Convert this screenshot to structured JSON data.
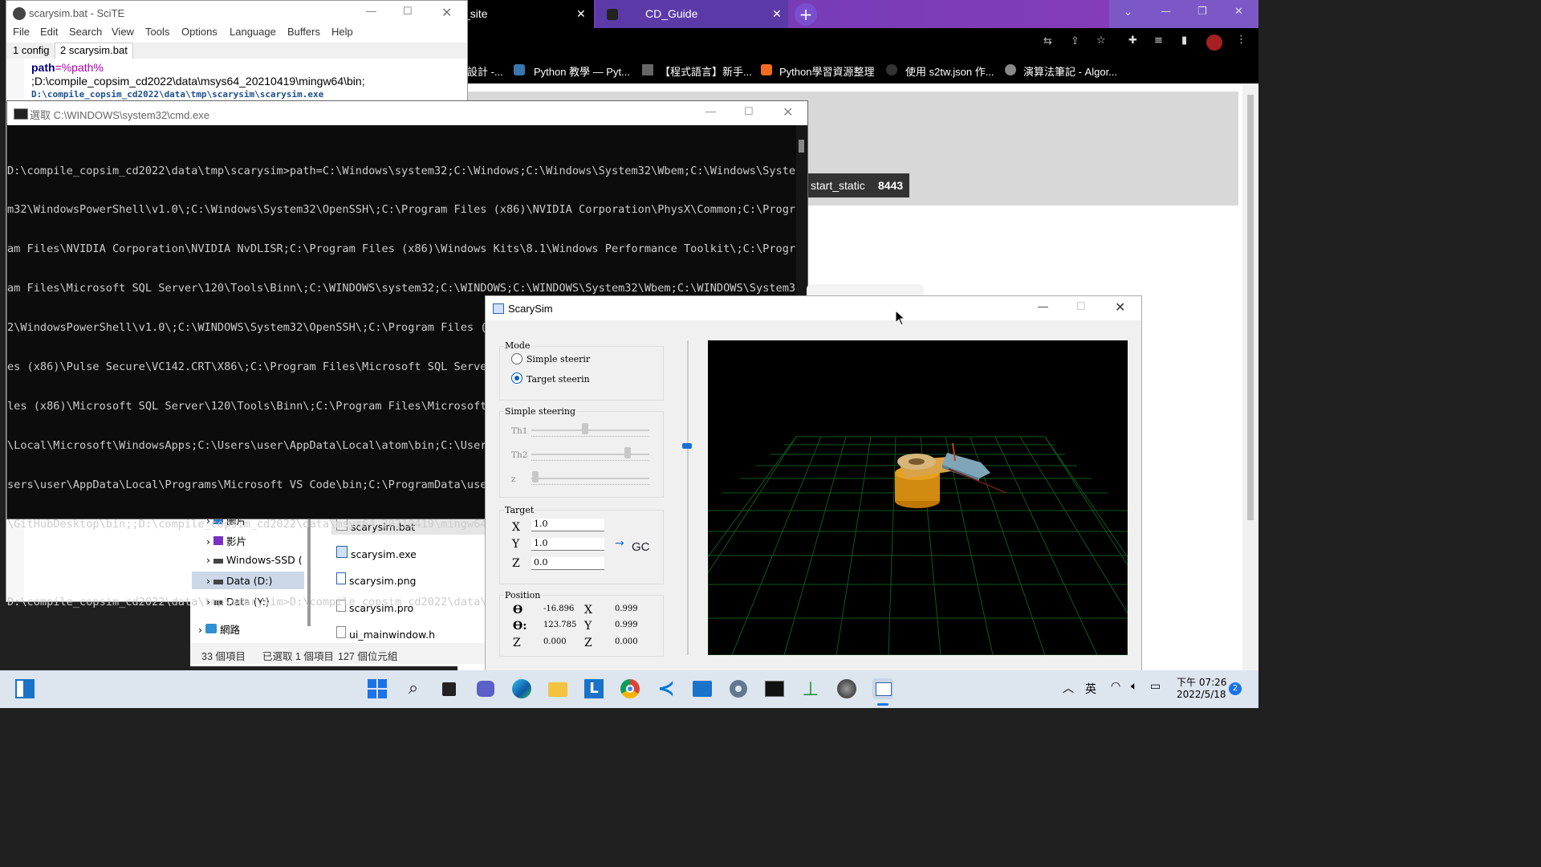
{
  "chrome": {
    "tabs": [
      {
        "title": "_site"
      },
      {
        "title": "CD_Guide"
      }
    ],
    "bookmarks": [
      "設計 -...",
      "Python 教學 — Pyt...",
      "【程式語言】新手...",
      "Python學習資源整理",
      "使用 s2tw.json 作...",
      "演算法筆記 - Algor..."
    ],
    "page": {
      "tag1": "start_static",
      "tag2": "8443"
    }
  },
  "scite": {
    "title": "scarysim.bat - SciTE",
    "menu": [
      "File",
      "Edit",
      "Search",
      "View",
      "Tools",
      "Options",
      "Language",
      "Buffers",
      "Help"
    ],
    "tabs": [
      "1 config",
      "2 scarysim.bat"
    ],
    "code": {
      "line1_kw": "path",
      "line1_rest": "=%path%",
      "line2": ";D:\\compile_copsim_cd2022\\data\\msys64_20210419\\mingw64\\bin;",
      "line3": "D:\\compile_copsim_cd2022\\data\\tmp\\scarysim\\scarysim.exe"
    }
  },
  "cmd": {
    "title": "選取 C:\\WINDOWS\\system32\\cmd.exe",
    "lines": [
      "D:\\compile_copsim_cd2022\\data\\tmp\\scarysim>path=C:\\Windows\\system32;C:\\Windows;C:\\Windows\\System32\\Wbem;C:\\Windows\\Syste",
      "m32\\WindowsPowerShell\\v1.0\\;C:\\Windows\\System32\\OpenSSH\\;C:\\Program Files (x86)\\NVIDIA Corporation\\PhysX\\Common;C:\\Progr",
      "am Files\\NVIDIA Corporation\\NVIDIA NvDLISR;C:\\Program Files (x86)\\Windows Kits\\8.1\\Windows Performance Toolkit\\;C:\\Progr",
      "am Files\\Microsoft SQL Server\\120\\Tools\\Binn\\;C:\\WINDOWS\\system32;C:\\WINDOWS;C:\\WINDOWS\\System32\\Wbem;C:\\WINDOWS\\System3",
      "2\\WindowsPowerShell\\v1.0\\;C:\\WINDOWS\\System32\\OpenSSH\\;C:\\Program Files (x86)\\Pulse Secure\\VC142.CRT\\X64\\;C:\\Program Fil",
      "es (x86)\\Pulse Secure\\VC142.CRT\\X86\\;C:\\Program Files\\Microsoft SQL Server\\Client SDK\\ODBC\\110\\Tools\\Binn\\;C:\\Program Fi",
      "les (x86)\\Microsoft SQL Server\\120\\Tools\\Binn\\;C:\\Program Files\\Microsoft SQL Server\\120\\DTS\\Binn\\;C:\\Users\\user\\AppData",
      "\\Local\\Microsoft\\WindowsApps;C:\\Users\\user\\AppData\\Local\\atom\\bin;C:\\Users\\user\\AppData\\Local\\Microsoft\\WindowsApps;C:\\U",
      "sers\\user\\AppData\\Local\\Programs\\Microsoft VS Code\\bin;C:\\ProgramData\\user\\GitHubDesktop\\bin;C:\\Users\\user\\AppData\\Local",
      "\\GitHubDesktop\\bin;;D:\\compile_copsim_cd2022\\data\\msys64_20210419\\mingw64\\bin;",
      "",
      "D:\\compile_copsim_cd2022\\data\\tmp\\scarysim>D:\\compile_copsim_cd2022\\data\\tmp\\scarysim\\scarysim.exe"
    ]
  },
  "explorer": {
    "tree": [
      {
        "label": "圖片"
      },
      {
        "label": "影片"
      },
      {
        "label": "Windows-SSD ("
      },
      {
        "label": "Data (D:)"
      },
      {
        "label": "Data (Y:)"
      },
      {
        "label": "網路"
      }
    ],
    "files": [
      "scarysim.bat",
      "scarysim.exe",
      "scarysim.png",
      "scarysim.pro",
      "ui_mainwindow.h"
    ],
    "status": {
      "count": "33 個項目",
      "selected": "已選取 1 個項目",
      "size": "127 個位元組"
    }
  },
  "sim": {
    "title": "ScarySim",
    "mode": {
      "label": "Mode",
      "opt1": "Simple steerir",
      "opt2": "Target steerin",
      "selected": "Target steerin"
    },
    "simple": {
      "label": "Simple steering",
      "th1": "Th1",
      "th2": "Th2",
      "z": "z"
    },
    "target": {
      "label": "Target",
      "x_label": "X",
      "y_label": "Y",
      "z_label": "Z",
      "x": "1.0",
      "y": "1.0",
      "z": "0.0",
      "go": "GC"
    },
    "position": {
      "label": "Position",
      "t1_label": "ϴ",
      "t2_label": "ϴ:",
      "z_label": "Z",
      "x_label": "X",
      "y_label": "Y",
      "z2_label": "Z",
      "t1": "-16.896",
      "t2": "123.785",
      "z": "0.000",
      "x": "0.999",
      "y": "0.999",
      "z2": "0.000"
    }
  },
  "taskbar": {
    "ime": "英",
    "time": "下午 07:26",
    "date": "2022/5/18",
    "notifications": "2"
  }
}
